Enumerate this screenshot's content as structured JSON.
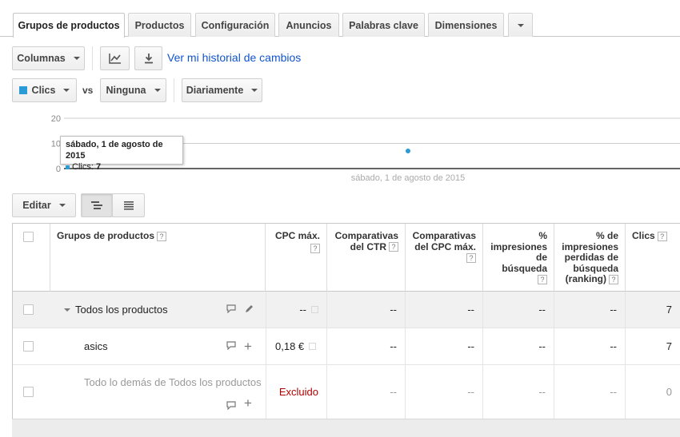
{
  "tabs": [
    {
      "label": "Grupos de productos",
      "active": true
    },
    {
      "label": "Productos",
      "active": false
    },
    {
      "label": "Configuración",
      "active": false
    },
    {
      "label": "Anuncios",
      "active": false
    },
    {
      "label": "Palabras clave",
      "active": false
    },
    {
      "label": "Dimensiones",
      "active": false
    }
  ],
  "toolbar": {
    "columns_label": "Columnas",
    "history_link": "Ver mi historial de cambios"
  },
  "metrics": {
    "primary_label": "Clics",
    "primary_color": "#2a9bd6",
    "vs_label": "vs",
    "secondary_label": "Ninguna",
    "period_label": "Diariamente"
  },
  "chart_data": {
    "type": "line",
    "x": [
      "sábado, 1 de agosto de 2015"
    ],
    "series": [
      {
        "name": "Clics",
        "values": [
          7
        ],
        "color": "#2a9bd6"
      }
    ],
    "ylim": [
      0,
      20
    ],
    "yticks": [
      0,
      10,
      20
    ],
    "tooltip": {
      "title": "sábado, 1 de agosto de 2015",
      "label": "Clics:",
      "value": "7"
    }
  },
  "table_toolbar": {
    "edit_label": "Editar"
  },
  "table": {
    "help_glyph": "?",
    "headers": {
      "product_groups": "Grupos de productos",
      "max_cpc": "CPC máx.",
      "ctr_line1": "Comparativas",
      "ctr_line2": "del CTR",
      "cpc_cmp_line1": "Comparativas",
      "cpc_cmp_line2": "del CPC máx.",
      "impr_line1": "%",
      "impr_line2": "impresiones",
      "impr_line3": "de",
      "impr_line4": "búsqueda",
      "lost_line1": "% de",
      "lost_line2": "impresiones",
      "lost_line3": "perdidas de",
      "lost_line4": "búsqueda",
      "lost_line5": "(ranking)",
      "clicks": "Clics"
    },
    "rows": [
      {
        "name": "Todos los productos",
        "cpc": "--",
        "ctr": "--",
        "cpc_cmp": "--",
        "impr": "--",
        "lost": "--",
        "clicks": "7"
      },
      {
        "name": "asics",
        "cpc": "0,18 €",
        "ctr": "--",
        "cpc_cmp": "--",
        "impr": "--",
        "lost": "--",
        "clicks": "7"
      },
      {
        "name": "Todo lo demás de Todos los productos",
        "cpc": "Excluido",
        "ctr": "--",
        "cpc_cmp": "--",
        "impr": "--",
        "lost": "--",
        "clicks": "0"
      }
    ]
  }
}
